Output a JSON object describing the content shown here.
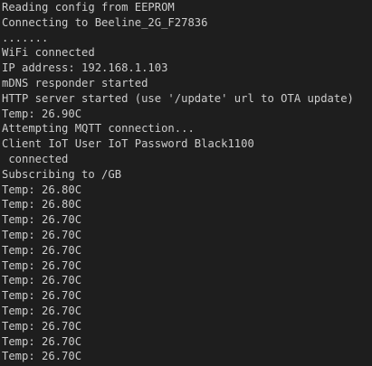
{
  "terminal": {
    "lines": [
      "Reading config from EEPROM",
      "Connecting to Beeline_2G_F27836",
      ".......",
      "WiFi connected",
      "IP address: 192.168.1.103",
      "mDNS responder started",
      "HTTP server started (use '/update' url to OTA update)",
      "Temp: 26.90C",
      "Attempting MQTT connection...",
      "Client IoT User IoT Password Black1100",
      " connected",
      "Subscribing to /GB",
      "Temp: 26.80C",
      "Temp: 26.80C",
      "Temp: 26.70C",
      "Temp: 26.70C",
      "Temp: 26.70C",
      "Temp: 26.70C",
      "Temp: 26.70C",
      "Temp: 26.70C",
      "Temp: 26.70C",
      "Temp: 26.70C",
      "Temp: 26.70C",
      "Temp: 26.70C"
    ]
  },
  "colors": {
    "background": "#1e1e1e",
    "text": "#cccccc"
  }
}
